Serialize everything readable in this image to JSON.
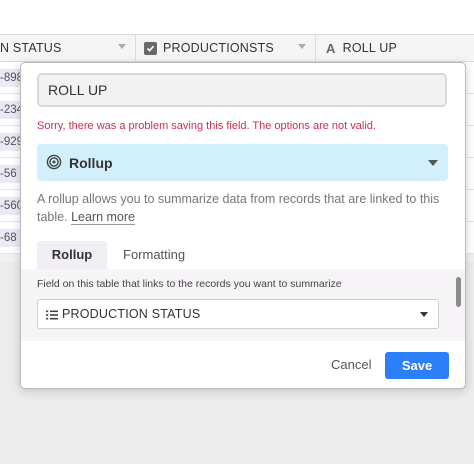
{
  "grid": {
    "columns": [
      {
        "label": "N STATUS"
      },
      {
        "label": "PRODUCTIONSTS",
        "icon": "checkbox-icon"
      },
      {
        "label": "ROLL UP",
        "icon": "text-a-icon"
      }
    ],
    "row_chips": [
      "-898",
      "-234",
      "-929",
      "-56",
      "-560",
      "-68"
    ]
  },
  "modal": {
    "field_name_value": "ROLL UP",
    "error_text": "Sorry, there was a problem saving this field. The options are not valid.",
    "field_type": {
      "label": "Rollup",
      "icon": "spiral-icon"
    },
    "description": "A rollup allows you to summarize data from records that are linked to this table.",
    "learn_more": "Learn more",
    "tabs": [
      "Rollup",
      "Formatting"
    ],
    "link_field_label": "Field on this table that links to the records you want to summarize",
    "link_field_value": "PRODUCTION STATUS",
    "cancel_label": "Cancel",
    "save_label": "Save"
  },
  "colors": {
    "accent": "#2d7ff9",
    "type_bg": "#d2f0fb",
    "error": "#d22b4b"
  }
}
